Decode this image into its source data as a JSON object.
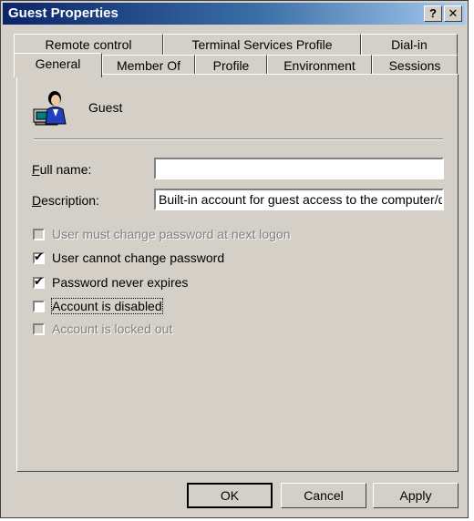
{
  "window": {
    "title": "Guest Properties",
    "help_label": "?",
    "close_label": "✕"
  },
  "tabs_back": [
    "Remote control",
    "Terminal Services Profile",
    "Dial-in"
  ],
  "tabs_front": [
    "General",
    "Member Of",
    "Profile",
    "Environment",
    "Sessions"
  ],
  "user": {
    "name": "Guest",
    "icon": "user-computer-icon"
  },
  "form": {
    "full_name_label": "Full name:",
    "full_name_value": "",
    "description_label": "Description:",
    "description_value": "Built-in account for guest access to the computer/d"
  },
  "checkboxes": [
    {
      "label": "User must change password at next logon",
      "checked": false,
      "enabled": false
    },
    {
      "label": "User cannot change password",
      "checked": true,
      "enabled": true
    },
    {
      "label": "Password never expires",
      "checked": true,
      "enabled": true
    },
    {
      "label": "Account is disabled",
      "checked": false,
      "enabled": true
    },
    {
      "label": "Account is locked out",
      "checked": false,
      "enabled": false
    }
  ],
  "buttons": {
    "ok": "OK",
    "cancel": "Cancel",
    "apply": "Apply"
  }
}
